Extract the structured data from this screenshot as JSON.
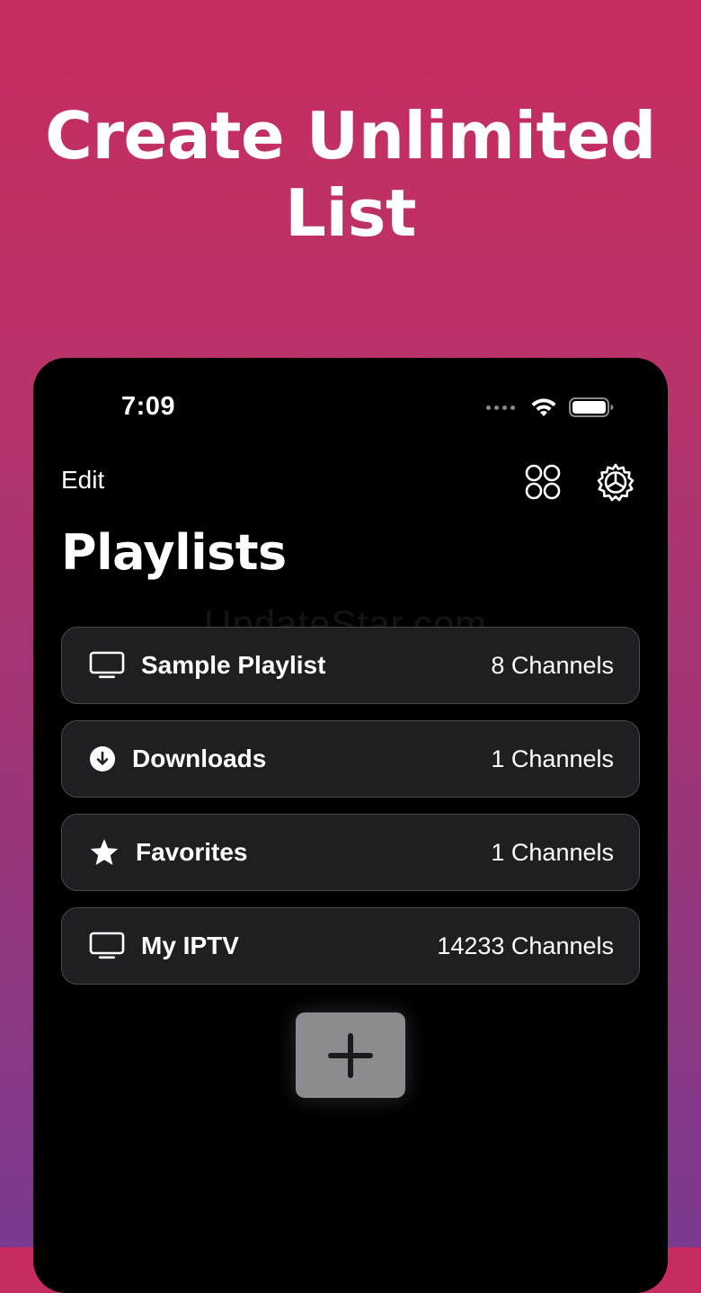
{
  "headline": {
    "line1": "Create Unlimited",
    "line2": "List"
  },
  "status_bar": {
    "time": "7:09",
    "icons": [
      "signal-dots-icon",
      "wifi-icon",
      "battery-icon"
    ]
  },
  "nav": {
    "edit_label": "Edit",
    "icons": [
      "grid-icon",
      "settings-icon"
    ]
  },
  "page_title": "Playlists",
  "watermark": "UpdateStar.com",
  "playlists": [
    {
      "icon": "tv-icon",
      "name": "Sample Playlist",
      "count": "8 Channels"
    },
    {
      "icon": "download-icon",
      "name": "Downloads",
      "count": "1 Channels"
    },
    {
      "icon": "star-icon",
      "name": "Favorites",
      "count": "1 Channels"
    },
    {
      "icon": "tv-icon",
      "name": "My IPTV",
      "count": "14233 Channels"
    }
  ],
  "add_button": {
    "icon": "plus-icon"
  },
  "colors": {
    "gradient_top": "#c72c60",
    "gradient_bottom": "#7a3a8f",
    "row_background": "#1f1f21",
    "add_button": "#8c8c90"
  }
}
